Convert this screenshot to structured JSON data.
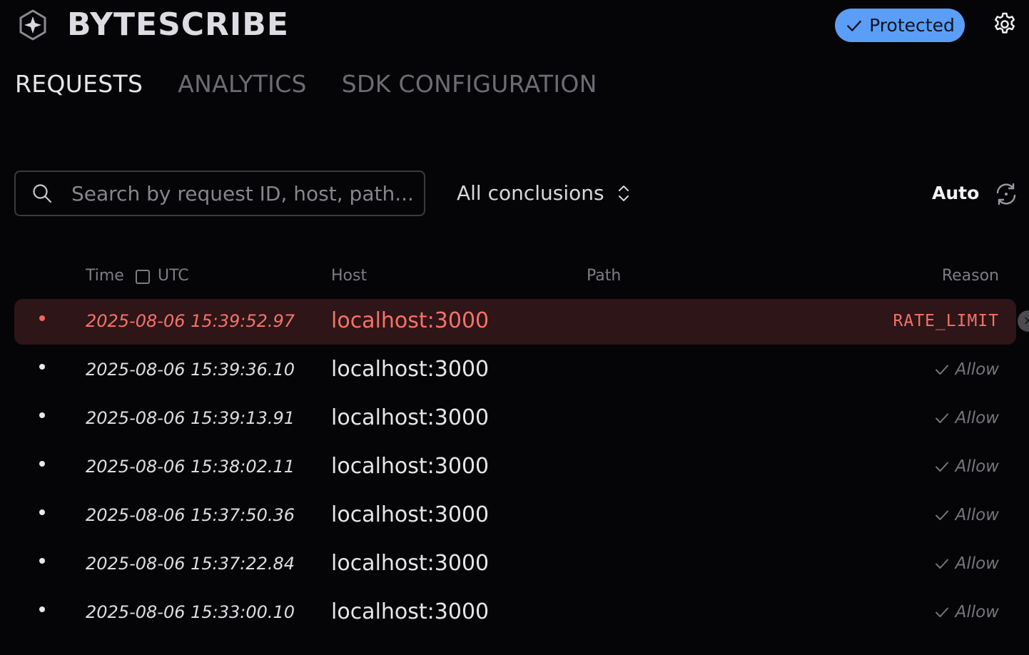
{
  "header": {
    "brand": "BYTESCRIBE",
    "status_label": "Protected",
    "status_color": "#5b9ef7",
    "logo_icon": "star-hexagon-icon",
    "settings_icon": "gear-icon"
  },
  "tabs": [
    {
      "label": "REQUESTS",
      "active": true
    },
    {
      "label": "ANALYTICS",
      "active": false
    },
    {
      "label": "SDK CONFIGURATION",
      "active": false
    }
  ],
  "toolbar": {
    "search_placeholder": "Search by request ID, host, path...",
    "search_value": "",
    "conclusions_value": "All conclusions",
    "refresh_mode": "Auto"
  },
  "table": {
    "columns": {
      "time": "Time",
      "utc": "UTC",
      "host": "Host",
      "path": "Path",
      "reason": "Reason"
    },
    "rows": [
      {
        "time": "2025-08-06 15:39:52.97",
        "host": "localhost:3000",
        "path": "",
        "reason": "RATE_LIMIT",
        "denied": true
      },
      {
        "time": "2025-08-06 15:39:36.10",
        "host": "localhost:3000",
        "path": "",
        "reason": "Allow",
        "denied": false
      },
      {
        "time": "2025-08-06 15:39:13.91",
        "host": "localhost:3000",
        "path": "",
        "reason": "Allow",
        "denied": false
      },
      {
        "time": "2025-08-06 15:38:02.11",
        "host": "localhost:3000",
        "path": "",
        "reason": "Allow",
        "denied": false
      },
      {
        "time": "2025-08-06 15:37:50.36",
        "host": "localhost:3000",
        "path": "",
        "reason": "Allow",
        "denied": false
      },
      {
        "time": "2025-08-06 15:37:22.84",
        "host": "localhost:3000",
        "path": "",
        "reason": "Allow",
        "denied": false
      },
      {
        "time": "2025-08-06 15:33:00.10",
        "host": "localhost:3000",
        "path": "",
        "reason": "Allow",
        "denied": false
      }
    ]
  },
  "colors": {
    "denied": "#f4726a",
    "denied_row_bg": "#2e1517",
    "accent": "#5b9ef7"
  }
}
